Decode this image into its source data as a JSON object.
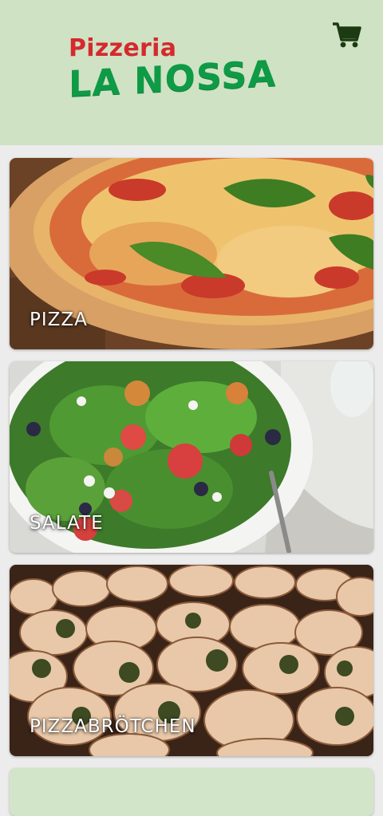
{
  "header": {
    "logo_line1": "Pizzeria",
    "logo_line2": "LA NOSSA",
    "cart_icon": "shopping-cart-icon"
  },
  "colors": {
    "header_bg": "#cfe2c4",
    "logo_red": "#d42a2e",
    "logo_green": "#0f9a46",
    "icon_dark_green": "#1c3b12"
  },
  "categories": [
    {
      "label": "PIZZA"
    },
    {
      "label": "SALATE"
    },
    {
      "label": "PIZZABRÖTCHEN"
    }
  ]
}
